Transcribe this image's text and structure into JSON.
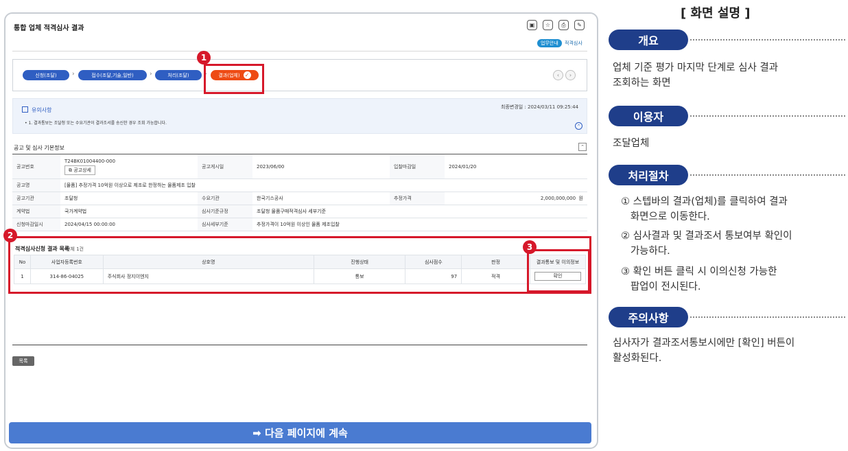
{
  "screen": {
    "title": "통합 업체 적격심사 결과",
    "toolbar_icons": [
      "save-icon",
      "star-icon",
      "print-icon",
      "settings-icon"
    ],
    "badge": "업무안내",
    "crumb_end": "적격심사",
    "steps": [
      {
        "label": "신청(조달)"
      },
      {
        "label": "접수(조달,기술,일반)"
      },
      {
        "label": "처리(조달)"
      },
      {
        "label": "결과(업체)"
      }
    ],
    "notice": {
      "title": "유의사항",
      "body": "• 1. 결과통보는 조달청 또는 수요기관이 결과조서를 송신한 경우 조회 가능합니다.",
      "date": "최종변경일 : 2024/03/11 09:25:44"
    },
    "info_section": {
      "title": "공고 및 심사 기본정보",
      "rows": {
        "r1": {
          "k1": "공고번호",
          "v1": "T24BK01004400-000",
          "v1_btn": "공고상세",
          "k2": "공고게시일",
          "v2": "2023/06/00",
          "k3": "입찰마감일",
          "v3": "2024/01/20"
        },
        "r2": {
          "k1": "공고명",
          "v1": "[물품] 추정가격 10억원 이상으로 제조로 한정하는 물품제조 입찰"
        },
        "r3": {
          "k1": "공고기관",
          "v1": "조달청",
          "k2": "수요기관",
          "v2": "한국기스공사",
          "k3": "추정가격",
          "v3": "2,000,000,000",
          "unit": "원"
        },
        "r4": {
          "k1": "계약법",
          "v1": "국가계약법",
          "k2": "심사기준규정",
          "v2": "조달청 물품구매적격심사 세부기준"
        },
        "r5": {
          "k1": "신청마감일시",
          "v1": "2024/04/15 00:00:00",
          "k2": "심사세부기준",
          "v2": "추정가격이 10억원 이상인 물품 제조입찰"
        }
      }
    },
    "result_section": {
      "title": "적격심사신청 결과 목록",
      "count": "전체 1건",
      "headers": [
        "No",
        "사업자등록번호",
        "상호명",
        "진행상태",
        "심사점수",
        "판정",
        "결과통보 및 이의정보"
      ],
      "rows": [
        {
          "no": "1",
          "biz_no": "314-86-04025",
          "name": "주식회사 정지이엔지",
          "status": "통보",
          "score": "97",
          "verdict": "적격",
          "action": "확인"
        }
      ]
    },
    "list_button": "목록",
    "next_bar": "➡ 다음 페이지에 계속"
  },
  "callouts": [
    "1",
    "2",
    "3"
  ],
  "panel": {
    "title": "[ 화면 설명 ]",
    "sections": {
      "overview": {
        "label": "개요",
        "text": "업체 기준 평가 마지막 단계로 심사 결과\n조회하는 화면"
      },
      "user": {
        "label": "이용자",
        "text": "조달업체"
      },
      "procedure": {
        "label": "처리절차",
        "items": [
          "① 스텝바의 결과(업체)를 클릭하여 결과\n   화면으로 이동한다.",
          "② 심사결과 및 결과조서 통보여부 확인이\n   가능하다.",
          "③ 확인 버튼 클릭 시 이의신청 가능한\n   팝업이 전시된다."
        ]
      },
      "caution": {
        "label": "주의사항",
        "text": "심사자가 결과조서통보시에만 [확인] 버튼이\n활성화된다."
      }
    }
  },
  "colors": {
    "accent_red": "#d6182a",
    "step_blue": "#2f5ec2",
    "step_current": "#ee4b14",
    "pill_navy": "#1f3e8a",
    "next_bar": "#4a7bd1"
  }
}
